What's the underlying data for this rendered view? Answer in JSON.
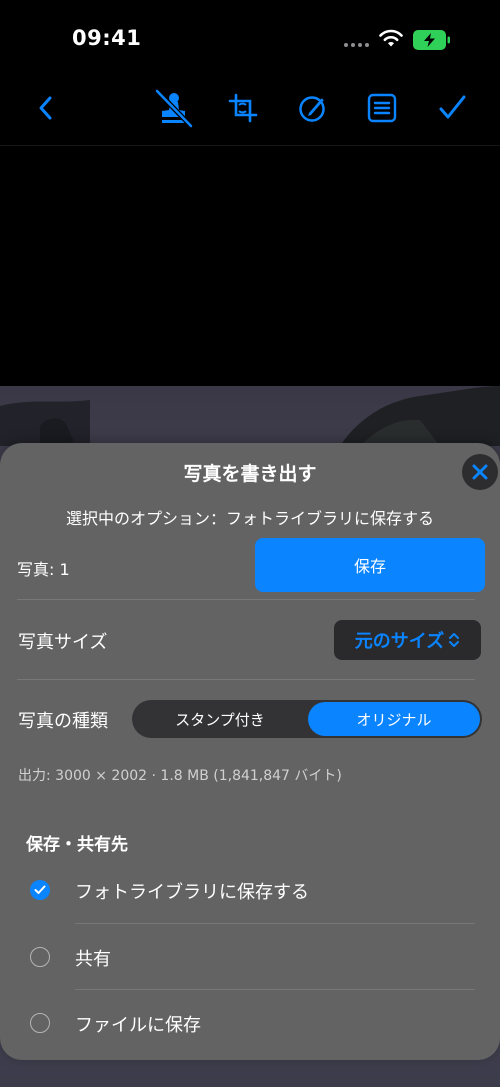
{
  "status_bar": {
    "time": "09:41"
  },
  "toolbar": {
    "icons": [
      "chevron-left-icon",
      "stamp-off-icon",
      "crop-icon",
      "edit-circle-icon",
      "list-icon",
      "checkmark-icon"
    ],
    "accent": "#0a84ff"
  },
  "sheet": {
    "title": "写真を書き出す",
    "subtitle": "選択中のオプション：フォトライブラリに保存する",
    "photo_count_label": "写真: 1",
    "save_label": "保存",
    "size_label": "写真サイズ",
    "size_value": "元のサイズ",
    "type_label": "写真の種類",
    "type_options": [
      {
        "label": "スタンプ付き",
        "selected": false
      },
      {
        "label": "オリジナル",
        "selected": true
      }
    ],
    "output_info": "出力: 3000 × 2002 · 1.8 MB (1,841,847 バイト)",
    "destination_title": "保存・共有先",
    "destinations": [
      {
        "label": "フォトライブラリに保存する",
        "selected": true
      },
      {
        "label": "共有",
        "selected": false
      },
      {
        "label": "ファイルに保存",
        "selected": false
      }
    ]
  },
  "colors": {
    "accent": "#0a84ff",
    "sheet_bg": "#636363",
    "battery": "#30d158"
  }
}
